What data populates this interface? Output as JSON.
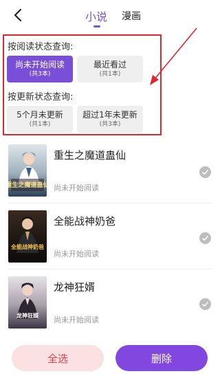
{
  "header": {
    "tabs": [
      {
        "label": "小说",
        "active": true
      },
      {
        "label": "漫画",
        "active": false
      }
    ],
    "accent_color": "#7a52d6"
  },
  "filters": {
    "read_status_label": "按阅读状态查询:",
    "update_status_label": "按更新状态查询:",
    "read_chips": [
      {
        "title": "尚未开始阅读",
        "count": "(共3本)",
        "active": true
      },
      {
        "title": "最近看过",
        "count": "(共1本)",
        "active": false
      }
    ],
    "update_chips": [
      {
        "title": "5个月未更新",
        "count": "(共1本)",
        "active": false
      },
      {
        "title": "超过1年未更新",
        "count": "(共3本)",
        "active": false
      }
    ],
    "highlight_color": "#e0262d"
  },
  "books": [
    {
      "title": "重生之魔道蛊仙",
      "status": "尚未开始阅读",
      "cover_text": "重生之魔道蛊仙"
    },
    {
      "title": "全能战神奶爸",
      "status": "尚未开始阅读",
      "cover_text": "全能战神奶爸"
    },
    {
      "title": "龙神狂婿",
      "status": "尚未开始阅读",
      "cover_text": "龙神狂婿"
    }
  ],
  "footer": {
    "select_all_label": "全选",
    "delete_label": "删除"
  }
}
